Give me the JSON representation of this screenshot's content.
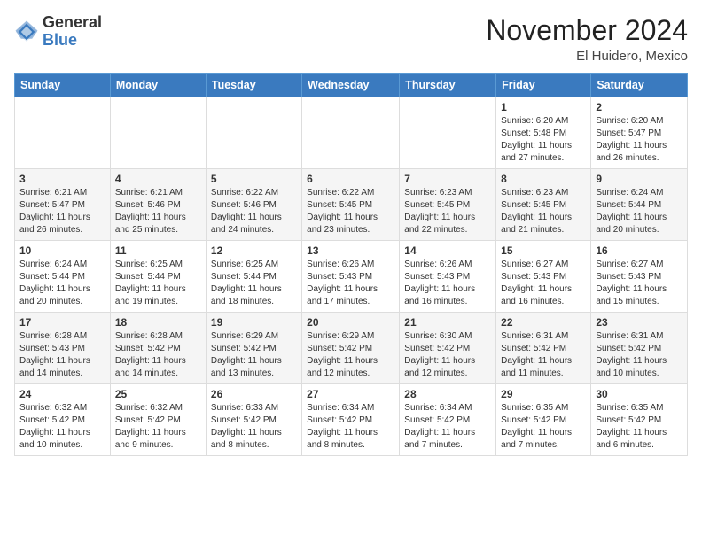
{
  "header": {
    "logo": {
      "general": "General",
      "blue": "Blue"
    },
    "title": "November 2024",
    "location": "El Huidero, Mexico"
  },
  "columns": [
    "Sunday",
    "Monday",
    "Tuesday",
    "Wednesday",
    "Thursday",
    "Friday",
    "Saturday"
  ],
  "weeks": [
    [
      {
        "day": "",
        "detail": ""
      },
      {
        "day": "",
        "detail": ""
      },
      {
        "day": "",
        "detail": ""
      },
      {
        "day": "",
        "detail": ""
      },
      {
        "day": "",
        "detail": ""
      },
      {
        "day": "1",
        "detail": "Sunrise: 6:20 AM\nSunset: 5:48 PM\nDaylight: 11 hours and 27 minutes."
      },
      {
        "day": "2",
        "detail": "Sunrise: 6:20 AM\nSunset: 5:47 PM\nDaylight: 11 hours and 26 minutes."
      }
    ],
    [
      {
        "day": "3",
        "detail": "Sunrise: 6:21 AM\nSunset: 5:47 PM\nDaylight: 11 hours and 26 minutes."
      },
      {
        "day": "4",
        "detail": "Sunrise: 6:21 AM\nSunset: 5:46 PM\nDaylight: 11 hours and 25 minutes."
      },
      {
        "day": "5",
        "detail": "Sunrise: 6:22 AM\nSunset: 5:46 PM\nDaylight: 11 hours and 24 minutes."
      },
      {
        "day": "6",
        "detail": "Sunrise: 6:22 AM\nSunset: 5:45 PM\nDaylight: 11 hours and 23 minutes."
      },
      {
        "day": "7",
        "detail": "Sunrise: 6:23 AM\nSunset: 5:45 PM\nDaylight: 11 hours and 22 minutes."
      },
      {
        "day": "8",
        "detail": "Sunrise: 6:23 AM\nSunset: 5:45 PM\nDaylight: 11 hours and 21 minutes."
      },
      {
        "day": "9",
        "detail": "Sunrise: 6:24 AM\nSunset: 5:44 PM\nDaylight: 11 hours and 20 minutes."
      }
    ],
    [
      {
        "day": "10",
        "detail": "Sunrise: 6:24 AM\nSunset: 5:44 PM\nDaylight: 11 hours and 20 minutes."
      },
      {
        "day": "11",
        "detail": "Sunrise: 6:25 AM\nSunset: 5:44 PM\nDaylight: 11 hours and 19 minutes."
      },
      {
        "day": "12",
        "detail": "Sunrise: 6:25 AM\nSunset: 5:44 PM\nDaylight: 11 hours and 18 minutes."
      },
      {
        "day": "13",
        "detail": "Sunrise: 6:26 AM\nSunset: 5:43 PM\nDaylight: 11 hours and 17 minutes."
      },
      {
        "day": "14",
        "detail": "Sunrise: 6:26 AM\nSunset: 5:43 PM\nDaylight: 11 hours and 16 minutes."
      },
      {
        "day": "15",
        "detail": "Sunrise: 6:27 AM\nSunset: 5:43 PM\nDaylight: 11 hours and 16 minutes."
      },
      {
        "day": "16",
        "detail": "Sunrise: 6:27 AM\nSunset: 5:43 PM\nDaylight: 11 hours and 15 minutes."
      }
    ],
    [
      {
        "day": "17",
        "detail": "Sunrise: 6:28 AM\nSunset: 5:43 PM\nDaylight: 11 hours and 14 minutes."
      },
      {
        "day": "18",
        "detail": "Sunrise: 6:28 AM\nSunset: 5:42 PM\nDaylight: 11 hours and 14 minutes."
      },
      {
        "day": "19",
        "detail": "Sunrise: 6:29 AM\nSunset: 5:42 PM\nDaylight: 11 hours and 13 minutes."
      },
      {
        "day": "20",
        "detail": "Sunrise: 6:29 AM\nSunset: 5:42 PM\nDaylight: 11 hours and 12 minutes."
      },
      {
        "day": "21",
        "detail": "Sunrise: 6:30 AM\nSunset: 5:42 PM\nDaylight: 11 hours and 12 minutes."
      },
      {
        "day": "22",
        "detail": "Sunrise: 6:31 AM\nSunset: 5:42 PM\nDaylight: 11 hours and 11 minutes."
      },
      {
        "day": "23",
        "detail": "Sunrise: 6:31 AM\nSunset: 5:42 PM\nDaylight: 11 hours and 10 minutes."
      }
    ],
    [
      {
        "day": "24",
        "detail": "Sunrise: 6:32 AM\nSunset: 5:42 PM\nDaylight: 11 hours and 10 minutes."
      },
      {
        "day": "25",
        "detail": "Sunrise: 6:32 AM\nSunset: 5:42 PM\nDaylight: 11 hours and 9 minutes."
      },
      {
        "day": "26",
        "detail": "Sunrise: 6:33 AM\nSunset: 5:42 PM\nDaylight: 11 hours and 8 minutes."
      },
      {
        "day": "27",
        "detail": "Sunrise: 6:34 AM\nSunset: 5:42 PM\nDaylight: 11 hours and 8 minutes."
      },
      {
        "day": "28",
        "detail": "Sunrise: 6:34 AM\nSunset: 5:42 PM\nDaylight: 11 hours and 7 minutes."
      },
      {
        "day": "29",
        "detail": "Sunrise: 6:35 AM\nSunset: 5:42 PM\nDaylight: 11 hours and 7 minutes."
      },
      {
        "day": "30",
        "detail": "Sunrise: 6:35 AM\nSunset: 5:42 PM\nDaylight: 11 hours and 6 minutes."
      }
    ]
  ]
}
